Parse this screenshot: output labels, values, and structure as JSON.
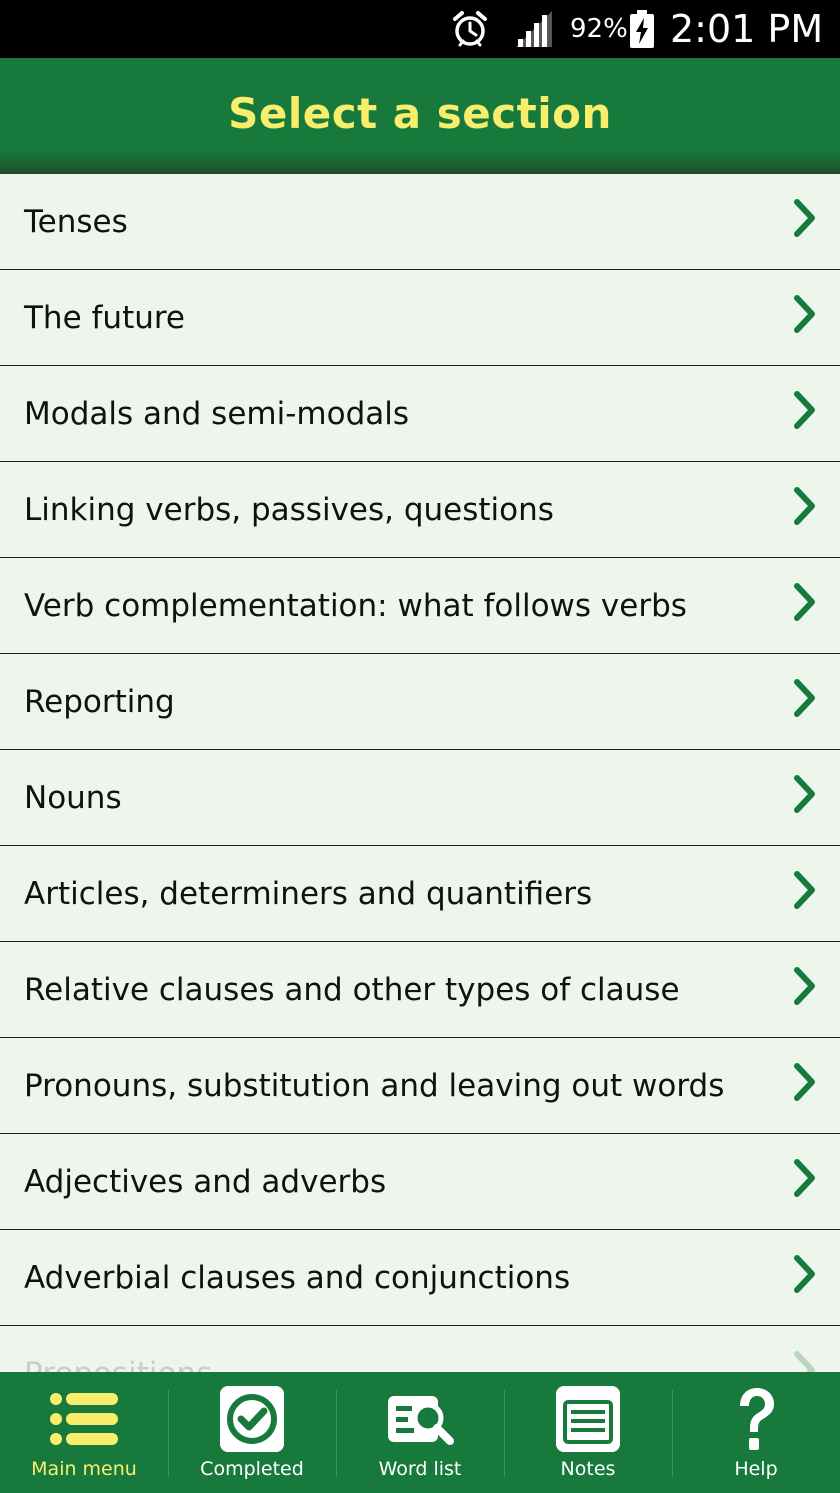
{
  "status_bar": {
    "battery_percent": "92%",
    "time": "2:01 PM",
    "icons": [
      "alarm-icon",
      "signal-icon",
      "battery-charging-icon"
    ]
  },
  "header": {
    "title": "Select a section"
  },
  "sections": [
    {
      "label": "Tenses"
    },
    {
      "label": "The future"
    },
    {
      "label": "Modals and semi-modals"
    },
    {
      "label": "Linking verbs, passives, questions"
    },
    {
      "label": "Verb complementation: what follows verbs"
    },
    {
      "label": "Reporting"
    },
    {
      "label": "Nouns"
    },
    {
      "label": "Articles, determiners and quantifiers"
    },
    {
      "label": "Relative clauses and other types of clause"
    },
    {
      "label": "Pronouns, substitution and leaving out words"
    },
    {
      "label": "Adjectives and adverbs"
    },
    {
      "label": "Adverbial clauses and conjunctions"
    },
    {
      "label": "Prepositions"
    }
  ],
  "bottom_nav": {
    "items": [
      {
        "label": "Main menu",
        "icon": "list-icon",
        "active": true
      },
      {
        "label": "Completed",
        "icon": "checkmark-icon",
        "active": false
      },
      {
        "label": "Word list",
        "icon": "word-search-icon",
        "active": false
      },
      {
        "label": "Notes",
        "icon": "notes-icon",
        "active": false
      },
      {
        "label": "Help",
        "icon": "question-icon",
        "active": false
      }
    ]
  },
  "colors": {
    "brand_green": "#177a3c",
    "title_yellow": "#f8ee6c",
    "list_background": "#eef5ec",
    "chevron_green": "#177a3c"
  }
}
